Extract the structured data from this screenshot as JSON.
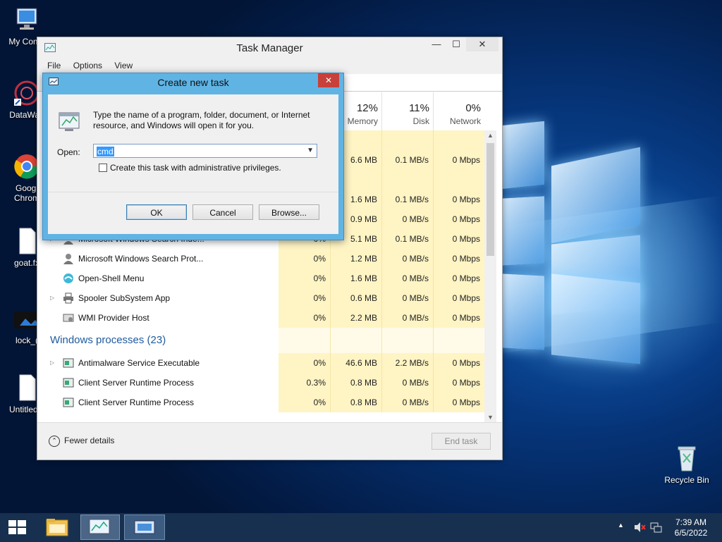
{
  "desktop": {
    "icons": [
      {
        "label": "My Comp",
        "icon": "computer-icon"
      },
      {
        "label": "DataWag",
        "icon": "datawag-icon"
      },
      {
        "label": "Googl​",
        "icon": "chrome-icon"
      },
      {
        "label": "Chrom",
        "icon": "chrome-icon"
      },
      {
        "label": "goat.fx",
        "icon": "file-icon"
      },
      {
        "label": "lock_(",
        "icon": "image-file-icon"
      },
      {
        "label": "Untitled.v",
        "icon": "file-icon"
      },
      {
        "label": "Recycle Bin",
        "icon": "recycle-bin-icon"
      }
    ]
  },
  "task_manager": {
    "title": "Task Manager",
    "menu": [
      "File",
      "Options",
      "View"
    ],
    "columns": [
      {
        "pct": "12%",
        "name": "Memory"
      },
      {
        "pct": "11%",
        "name": "Disk"
      },
      {
        "pct": "0%",
        "name": "Network"
      }
    ],
    "rows_top": [
      {
        "mem": "6.6 MB",
        "disk": "0.1 MB/s",
        "net": "0 Mbps"
      },
      {
        "mem": "1.6 MB",
        "disk": "0.1 MB/s",
        "net": "0 Mbps"
      },
      {
        "mem": "0.9 MB",
        "disk": "0 MB/s",
        "net": "0 Mbps"
      }
    ],
    "processes": [
      {
        "name": "Microsoft Windows Search Inde...",
        "cpu": "0%",
        "mem": "5.1 MB",
        "disk": "0.1 MB/s",
        "net": "0 Mbps",
        "expand": "▷"
      },
      {
        "name": "Microsoft Windows Search Prot...",
        "cpu": "0%",
        "mem": "1.2 MB",
        "disk": "0 MB/s",
        "net": "0 Mbps",
        "expand": ""
      },
      {
        "name": "Open-Shell Menu",
        "cpu": "0%",
        "mem": "1.6 MB",
        "disk": "0 MB/s",
        "net": "0 Mbps",
        "expand": ""
      },
      {
        "name": "Spooler SubSystem App",
        "cpu": "0%",
        "mem": "0.6 MB",
        "disk": "0 MB/s",
        "net": "0 Mbps",
        "expand": "▷"
      },
      {
        "name": "WMI Provider Host",
        "cpu": "0%",
        "mem": "2.2 MB",
        "disk": "0 MB/s",
        "net": "0 Mbps",
        "expand": ""
      }
    ],
    "group_windows": "Windows processes (23)",
    "windows_processes": [
      {
        "name": "Antimalware Service Executable",
        "cpu": "0%",
        "mem": "46.6 MB",
        "disk": "2.2 MB/s",
        "net": "0 Mbps",
        "expand": "▷"
      },
      {
        "name": "Client Server Runtime Process",
        "cpu": "0.3%",
        "mem": "0.8 MB",
        "disk": "0 MB/s",
        "net": "0 Mbps",
        "expand": ""
      },
      {
        "name": "Client Server Runtime Process",
        "cpu": "0%",
        "mem": "0.8 MB",
        "disk": "0 MB/s",
        "net": "0 Mbps",
        "expand": ""
      }
    ],
    "fewer_details": "Fewer details",
    "end_task": "End task"
  },
  "dialog": {
    "title": "Create new task",
    "close": "✕",
    "description": "Type the name of a program, folder, document, or Internet resource, and Windows will open it for you.",
    "open_label": "Open:",
    "open_value": "cmd",
    "admin_checkbox_label": "Create this task with administrative privileges.",
    "ok": "OK",
    "cancel": "Cancel",
    "browse": "Browse..."
  },
  "taskbar": {
    "time": "7:39 AM",
    "date": "6/5/2022",
    "tray_arrow": "▲"
  },
  "window_controls": {
    "minimize": "—",
    "maximize": "☐",
    "close": "✕"
  }
}
